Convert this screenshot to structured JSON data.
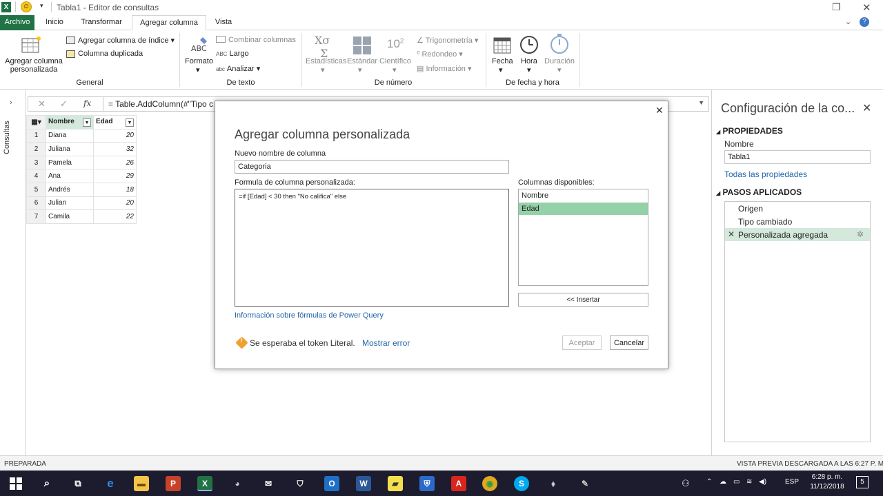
{
  "window": {
    "title": "Tabla1 - Editor de consultas",
    "qat_arrow": "▾"
  },
  "tabs": [
    {
      "label": "Archivo"
    },
    {
      "label": "Inicio"
    },
    {
      "label": "Transformar"
    },
    {
      "label": "Agregar columna"
    },
    {
      "label": "Vista"
    }
  ],
  "ribbon": {
    "custom_column_l1": "Agregar columna",
    "custom_column_l2": "personalizada",
    "index_column": "Agregar columna de índice",
    "duplicate_column": "Columna duplicada",
    "group_general": "General",
    "format": "Formato",
    "merge_columns": "Combinar columnas",
    "length": "Largo",
    "parse": "Analizar",
    "group_text": "De texto",
    "statistics": "Estadísticas",
    "standard": "Estándar",
    "scientific": "Científico",
    "trigonometry": "Trigonometría",
    "rounding": "Redondeo",
    "information": "Información",
    "group_number": "De número",
    "date": "Fecha",
    "time": "Hora",
    "duration": "Duración",
    "group_datetime": "De fecha y hora"
  },
  "left_panel": {
    "label": "Consultas"
  },
  "formula_bar": {
    "cancel": "✕",
    "accept": "✓",
    "fx": "fx",
    "text": "= Table.AddColumn(#\"Tipo c"
  },
  "grid": {
    "columns": [
      "Nombre",
      "Edad"
    ],
    "rows": [
      {
        "n": "1",
        "name": "Diana",
        "age": "20"
      },
      {
        "n": "2",
        "name": "Juliana",
        "age": "32"
      },
      {
        "n": "3",
        "name": "Pamela",
        "age": "26"
      },
      {
        "n": "4",
        "name": "Ana",
        "age": "29"
      },
      {
        "n": "5",
        "name": "Andrés",
        "age": "18"
      },
      {
        "n": "6",
        "name": "Julian",
        "age": "20"
      },
      {
        "n": "7",
        "name": "Camila",
        "age": "22"
      }
    ]
  },
  "query_settings": {
    "title": "Configuración de la co...",
    "properties_header": "PROPIEDADES",
    "name_label": "Nombre",
    "name_value": "Tabla1",
    "all_properties": "Todas las propiedades",
    "steps_header": "PASOS APLICADOS",
    "steps": [
      "Origen",
      "Tipo cambiado",
      "Personalizada agregada"
    ]
  },
  "dialog": {
    "title": "Agregar columna personalizada",
    "new_name_label": "Nuevo nombre de columna",
    "new_name_value": "Categoria",
    "formula_label": "Formula de columna personalizada:",
    "formula_value": "=if [Edad] < 30 then \"No califica\" else",
    "available_label": "Columnas disponibles:",
    "available": [
      "Nombre",
      "Edad"
    ],
    "insert": "<< Insertar",
    "help_link": "Información sobre fórmulas de Power Query",
    "error_text": "Se esperaba el token Literal.",
    "show_error": "Mostrar error",
    "ok": "Aceptar",
    "cancel": "Cancelar"
  },
  "status": {
    "left": "PREPARADA",
    "right": "VISTA PREVIA DESCARGADA A LAS 6:27 P. M."
  },
  "taskbar": {
    "lang": "ESP",
    "time": "6:28 p. m.",
    "date": "11/12/2018",
    "notifications": "5"
  }
}
